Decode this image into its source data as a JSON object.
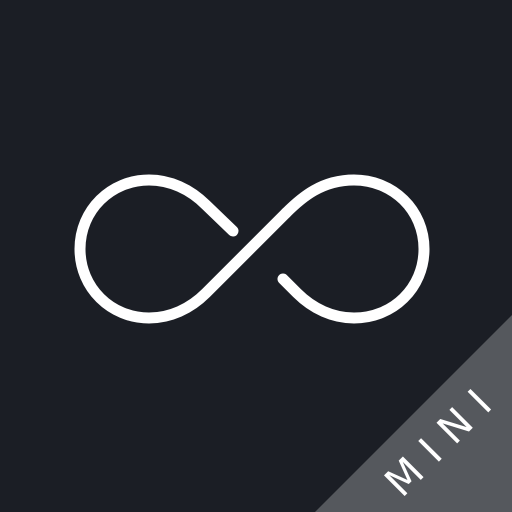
{
  "app_icon": {
    "background_color": "#1b1e25",
    "symbol": "infinity-icon",
    "symbol_color": "#ffffff",
    "corner_banner": {
      "label": "MINI",
      "background_color": "#55585d",
      "text_color": "#ffffff"
    }
  }
}
